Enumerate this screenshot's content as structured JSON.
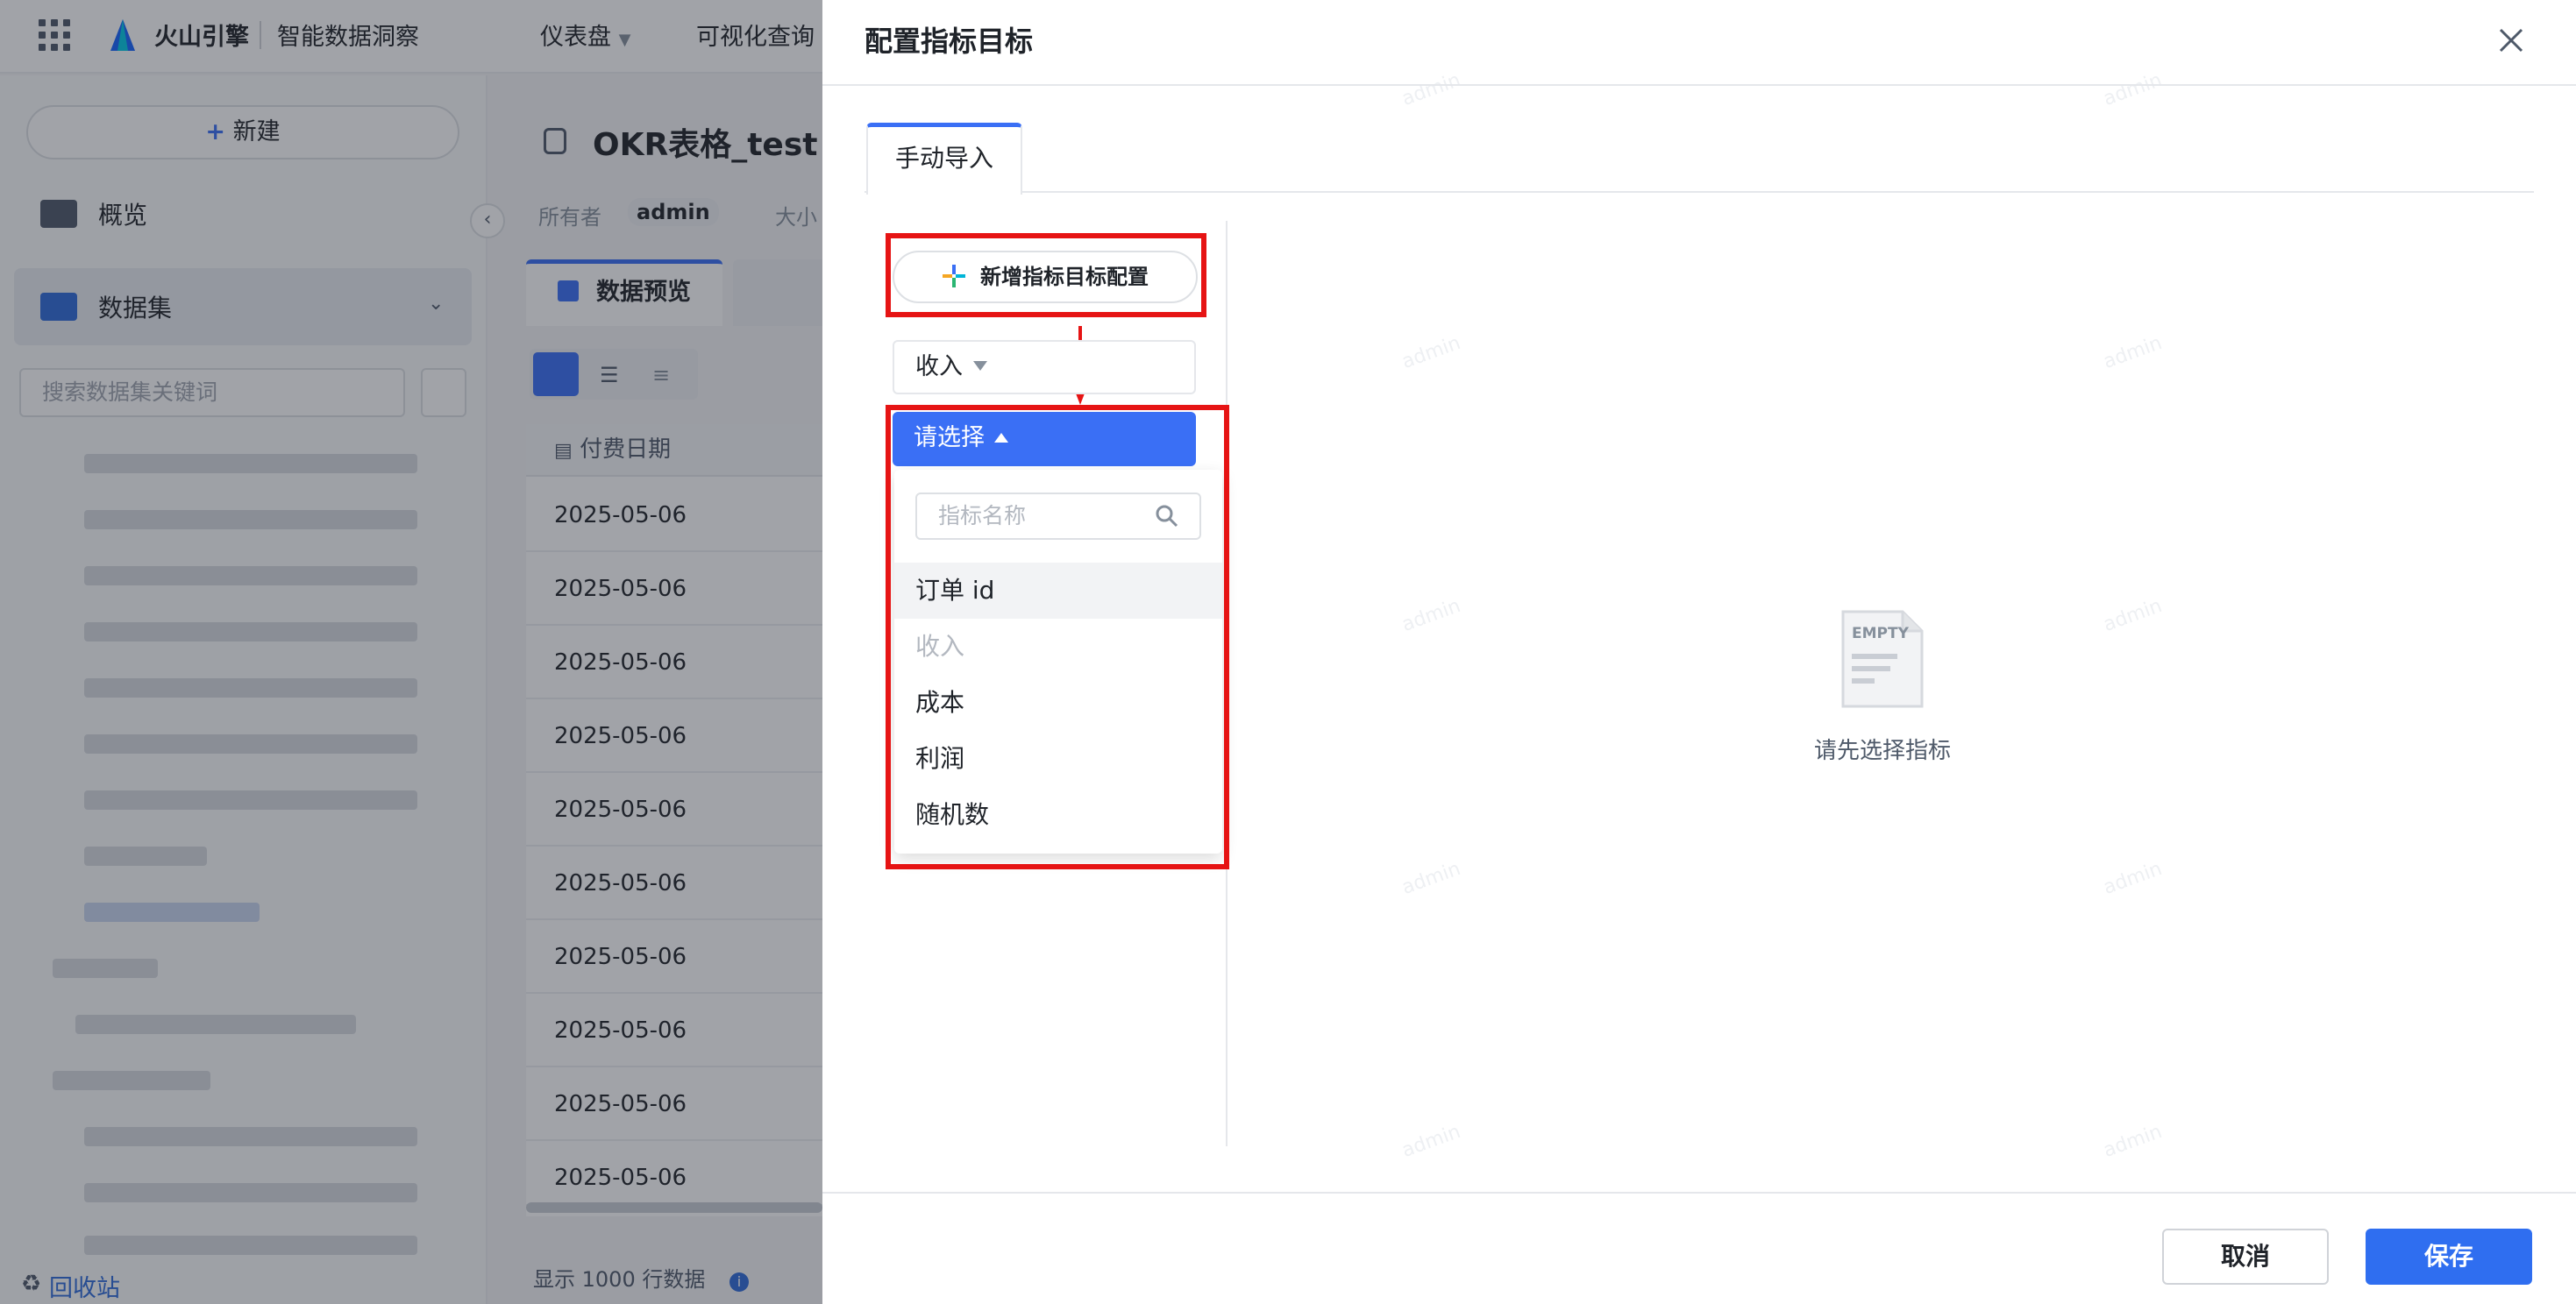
{
  "app": {
    "brand": "火山引擎",
    "product": "智能数据洞察",
    "nav": [
      "仪表盘",
      "可视化查询"
    ]
  },
  "sidebar": {
    "new_label": "新建",
    "overview_label": "概览",
    "dataset_label": "数据集",
    "search_placeholder": "搜索数据集关键词",
    "recycle_label": "回收站"
  },
  "main": {
    "title": "OKR表格_test",
    "owner_label": "所有者",
    "owner_name": "admin",
    "size_label": "大小",
    "tab_preview": "数据预览",
    "column_header": "付费日期",
    "rows": [
      "2025-05-06",
      "2025-05-06",
      "2025-05-06",
      "2025-05-06",
      "2025-05-06",
      "2025-05-06",
      "2025-05-06",
      "2025-05-06",
      "2025-05-06",
      "2025-05-06"
    ],
    "footer_prefix": "显示",
    "footer_count": "1000",
    "footer_suffix": "行数据"
  },
  "modal": {
    "title": "配置指标目标",
    "tab_label": "手动导入",
    "add_button": "新增指标目标配置",
    "selected_metric": "收入",
    "select_placeholder": "请选择",
    "search_placeholder": "指标名称",
    "options": [
      {
        "label": "订单 id",
        "state": "hover"
      },
      {
        "label": "收入",
        "state": "disabled"
      },
      {
        "label": "成本",
        "state": "normal"
      },
      {
        "label": "利润",
        "state": "normal"
      },
      {
        "label": "随机数",
        "state": "normal"
      }
    ],
    "empty_image_text": "EMPTY",
    "empty_text": "请先选择指标",
    "cancel_label": "取消",
    "save_label": "保存",
    "watermark": "admin"
  },
  "colors": {
    "accent": "#3a6ff5",
    "highlight_box": "#e61414",
    "mask": "rgba(30,36,48,0.42)"
  }
}
